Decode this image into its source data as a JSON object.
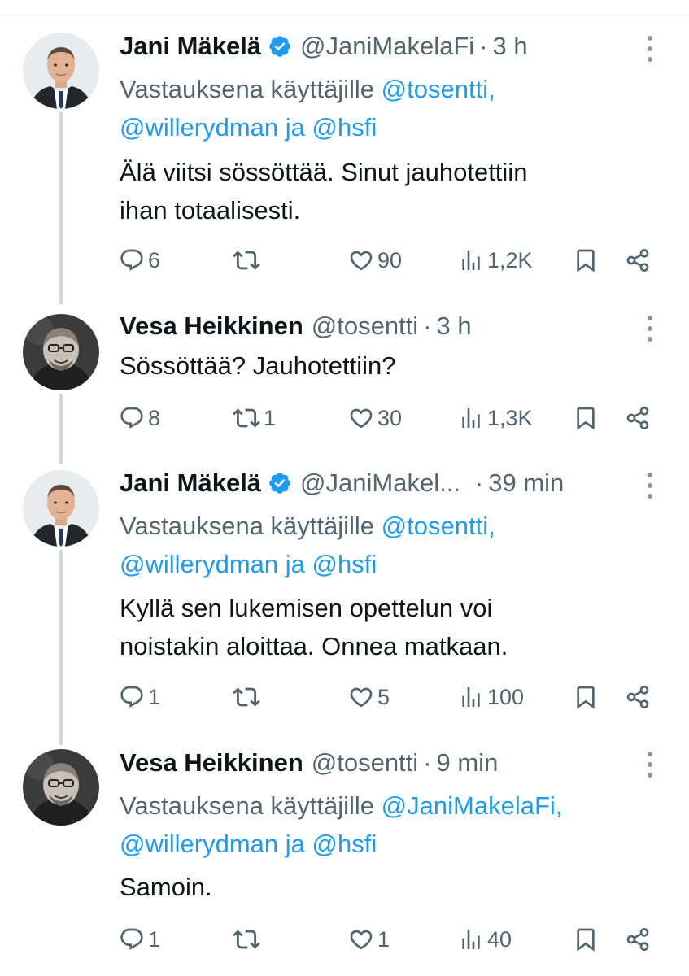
{
  "tweets": [
    {
      "name": "Jani Mäkelä",
      "verified": true,
      "handle": "@JaniMakelaFi",
      "time": "3 h",
      "reply_prefix": "Vastauksena käyttäjille",
      "reply_mention_1": "@tosentti,",
      "reply_mention_2": "@willerydman",
      "reply_and": "ja",
      "reply_mention_3": "@hsfi",
      "text_line_1": "Älä viitsi sössöttää. Sinut jauhotettiin",
      "text_line_2": "ihan totaalisesti.",
      "replies": "6",
      "retweets": "",
      "likes": "90",
      "views": "1,2K"
    },
    {
      "name": "Vesa Heikkinen",
      "verified": false,
      "handle": "@tosentti",
      "time": "3 h",
      "text_line_1": "Sössöttää? Jauhotettiin?",
      "replies": "8",
      "retweets": "1",
      "likes": "30",
      "views": "1,3K"
    },
    {
      "name": "Jani Mäkelä",
      "verified": true,
      "handle": "@JaniMakel...",
      "time": "39 min",
      "reply_prefix": "Vastauksena käyttäjille",
      "reply_mention_1": "@tosentti,",
      "reply_mention_2": "@willerydman",
      "reply_and": "ja",
      "reply_mention_3": "@hsfi",
      "text_line_1": "Kyllä sen lukemisen opettelun voi",
      "text_line_2": "noistakin aloittaa. Onnea matkaan.",
      "replies": "1",
      "retweets": "",
      "likes": "5",
      "views": "100"
    },
    {
      "name": "Vesa Heikkinen",
      "verified": false,
      "handle": "@tosentti",
      "time": "9 min",
      "reply_prefix": "Vastauksena käyttäjille",
      "reply_mention_1": "@JaniMakelaFi,",
      "reply_mention_2": "@willerydman",
      "reply_and": "ja",
      "reply_mention_3": "@hsfi",
      "text_line_1": "Samoin.",
      "replies": "1",
      "retweets": "",
      "likes": "1",
      "views": "40"
    }
  ],
  "separator": "·",
  "icons": {
    "reply": "reply-icon",
    "retweet": "retweet-icon",
    "like": "heart-icon",
    "views": "views-icon",
    "bookmark": "bookmark-icon",
    "share": "share-icon",
    "verified": "verified-badge-icon",
    "more": "more-options-icon"
  },
  "colors": {
    "link": "#1d9bf0",
    "muted": "#536471",
    "text": "#0f1419",
    "thread_line": "#cfd9de"
  }
}
